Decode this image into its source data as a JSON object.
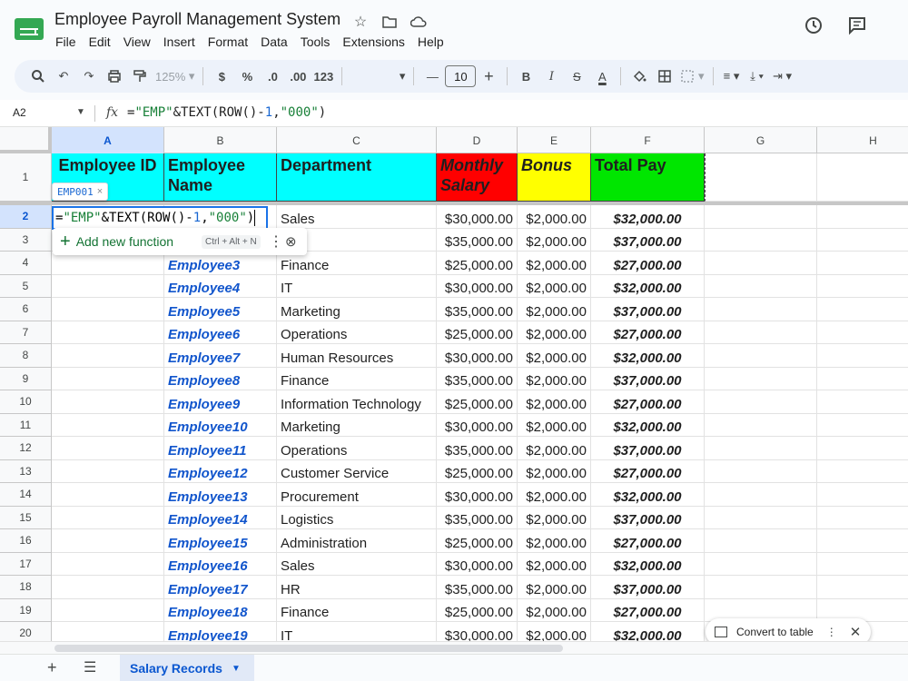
{
  "app": {
    "doc_title": "Employee Payroll Management System",
    "menu": [
      "File",
      "Edit",
      "View",
      "Insert",
      "Format",
      "Data",
      "Tools",
      "Extensions",
      "Help"
    ],
    "title_icons": [
      "star-icon",
      "move-folder-icon",
      "cloud-status-icon"
    ],
    "top_right_icons": [
      "version-history-icon",
      "comments-icon"
    ]
  },
  "toolbar": {
    "zoom": "125%",
    "currency": "$",
    "percent": "%",
    "decrease_decimal": ".0",
    "increase_decimal": ".00",
    "more_formats": "123",
    "font_size": "10",
    "bold": "B",
    "italic": "I",
    "strikethrough": "S",
    "text_color": "A"
  },
  "formula_bar": {
    "cell_ref": "A2",
    "fx": "fx",
    "formula_parts": [
      "=",
      "\"EMP\"",
      "&TEXT(ROW()-",
      "1",
      ",",
      "\"000\"",
      ")"
    ]
  },
  "columns": [
    {
      "label": "A",
      "selected": true
    },
    {
      "label": "B"
    },
    {
      "label": "C"
    },
    {
      "label": "D"
    },
    {
      "label": "E"
    },
    {
      "label": "F"
    },
    {
      "label": "G"
    },
    {
      "label": "H"
    }
  ],
  "headers": {
    "a": "Employee ID",
    "b": "Employee Name",
    "c": "Department",
    "d": "Monthly Salary",
    "e": "Bonus",
    "f": "Total Pay"
  },
  "header_colors": {
    "cyan": "#00ffff",
    "red": "#ff0000",
    "yellow": "#ffff00",
    "green": "#00e600"
  },
  "rows": [
    {
      "n": "2",
      "name": "",
      "dept": "Sales",
      "salary": "$30,000.00",
      "bonus": "$2,000.00",
      "total": "$32,000.00"
    },
    {
      "n": "3",
      "name": "",
      "dept": "",
      "salary": "$35,000.00",
      "bonus": "$2,000.00",
      "total": "$37,000.00"
    },
    {
      "n": "4",
      "name": "Employee3",
      "dept": "Finance",
      "salary": "$25,000.00",
      "bonus": "$2,000.00",
      "total": "$27,000.00"
    },
    {
      "n": "5",
      "name": "Employee4",
      "dept": "IT",
      "salary": "$30,000.00",
      "bonus": "$2,000.00",
      "total": "$32,000.00"
    },
    {
      "n": "6",
      "name": "Employee5",
      "dept": "Marketing",
      "salary": "$35,000.00",
      "bonus": "$2,000.00",
      "total": "$37,000.00"
    },
    {
      "n": "7",
      "name": "Employee6",
      "dept": "Operations",
      "salary": "$25,000.00",
      "bonus": "$2,000.00",
      "total": "$27,000.00"
    },
    {
      "n": "8",
      "name": "Employee7",
      "dept": "Human Resources",
      "salary": "$30,000.00",
      "bonus": "$2,000.00",
      "total": "$32,000.00"
    },
    {
      "n": "9",
      "name": "Employee8",
      "dept": "Finance",
      "salary": "$35,000.00",
      "bonus": "$2,000.00",
      "total": "$37,000.00"
    },
    {
      "n": "10",
      "name": "Employee9",
      "dept": "Information Technology",
      "salary": "$25,000.00",
      "bonus": "$2,000.00",
      "total": "$27,000.00"
    },
    {
      "n": "11",
      "name": "Employee10",
      "dept": "Marketing",
      "salary": "$30,000.00",
      "bonus": "$2,000.00",
      "total": "$32,000.00"
    },
    {
      "n": "12",
      "name": "Employee11",
      "dept": "Operations",
      "salary": "$35,000.00",
      "bonus": "$2,000.00",
      "total": "$37,000.00"
    },
    {
      "n": "13",
      "name": "Employee12",
      "dept": "Customer Service",
      "salary": "$25,000.00",
      "bonus": "$2,000.00",
      "total": "$27,000.00"
    },
    {
      "n": "14",
      "name": "Employee13",
      "dept": "Procurement",
      "salary": "$30,000.00",
      "bonus": "$2,000.00",
      "total": "$32,000.00"
    },
    {
      "n": "15",
      "name": "Employee14",
      "dept": "Logistics",
      "salary": "$35,000.00",
      "bonus": "$2,000.00",
      "total": "$37,000.00"
    },
    {
      "n": "16",
      "name": "Employee15",
      "dept": "Administration",
      "salary": "$25,000.00",
      "bonus": "$2,000.00",
      "total": "$27,000.00"
    },
    {
      "n": "17",
      "name": "Employee16",
      "dept": "Sales",
      "salary": "$30,000.00",
      "bonus": "$2,000.00",
      "total": "$32,000.00"
    },
    {
      "n": "18",
      "name": "Employee17",
      "dept": "HR",
      "salary": "$35,000.00",
      "bonus": "$2,000.00",
      "total": "$37,000.00"
    },
    {
      "n": "19",
      "name": "Employee18",
      "dept": "Finance",
      "salary": "$25,000.00",
      "bonus": "$2,000.00",
      "total": "$27,000.00"
    },
    {
      "n": "20",
      "name": "Employee19",
      "dept": "IT",
      "salary": "$30,000.00",
      "bonus": "$2,000.00",
      "total": "$32,000.00"
    }
  ],
  "row1_label": "1",
  "editor": {
    "preview": "EMP001",
    "preview_close": "×",
    "suggest_label": "Add new function",
    "suggest_shortcut": "Ctrl + Alt + N"
  },
  "convert_chip": {
    "label": "Convert to table"
  },
  "sheets": {
    "active": "Salary Records"
  }
}
